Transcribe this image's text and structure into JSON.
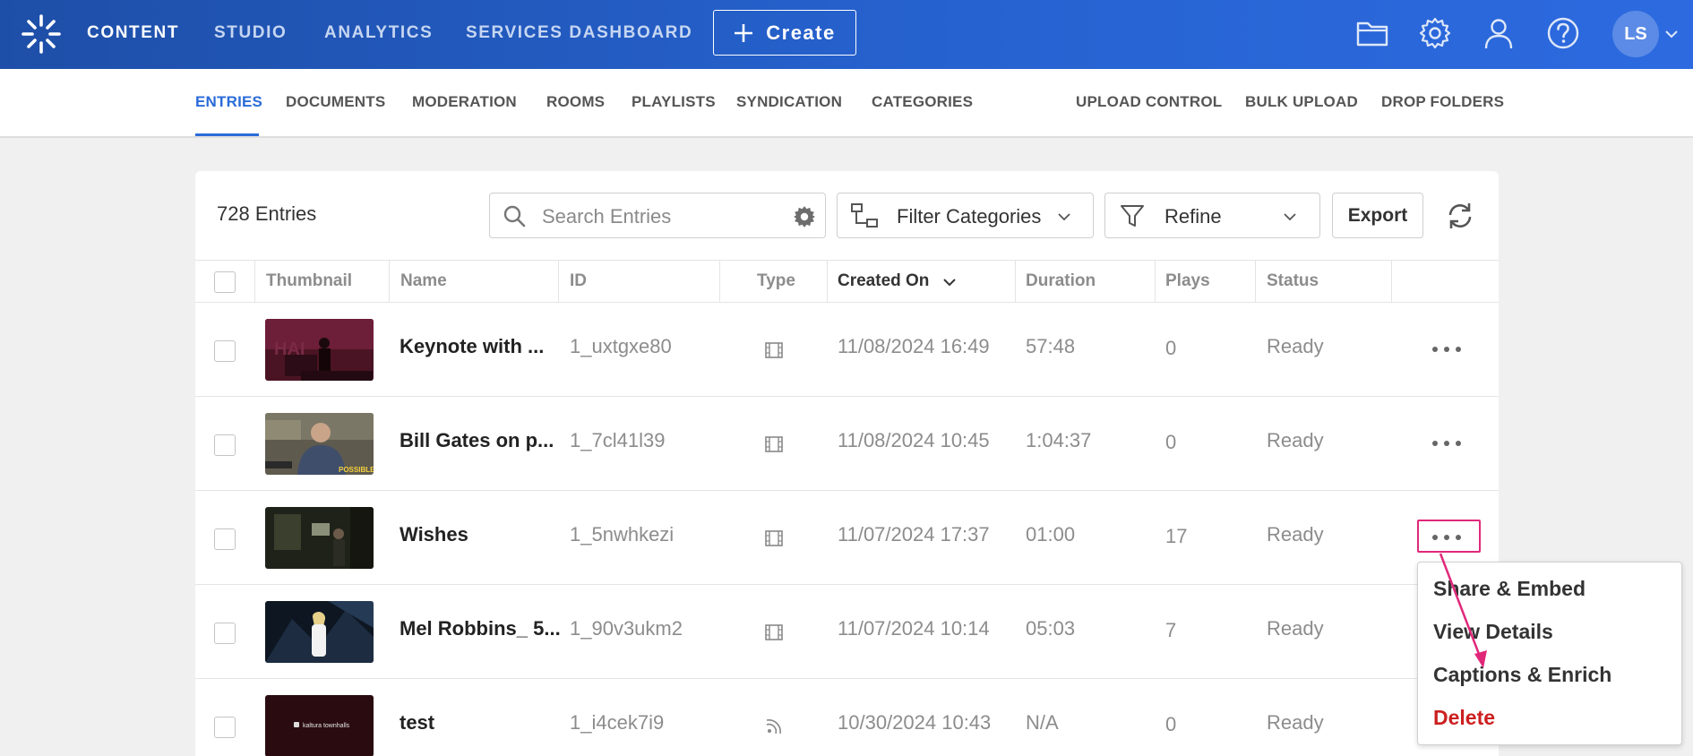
{
  "header": {
    "nav": [
      {
        "label": "CONTENT",
        "active": true
      },
      {
        "label": "STUDIO",
        "active": false
      },
      {
        "label": "ANALYTICS",
        "active": false
      },
      {
        "label": "SERVICES DASHBOARD",
        "active": false
      }
    ],
    "create_label": "Create",
    "icons": [
      "folder-icon",
      "gear-icon",
      "user-icon",
      "help-icon"
    ],
    "avatar_initials": "LS"
  },
  "subnav": {
    "left": [
      "ENTRIES",
      "DOCUMENTS",
      "MODERATION",
      "ROOMS",
      "PLAYLISTS",
      "SYNDICATION",
      "CATEGORIES"
    ],
    "right": [
      "UPLOAD CONTROL",
      "BULK UPLOAD",
      "DROP FOLDERS"
    ],
    "active": "ENTRIES"
  },
  "toolbar": {
    "entries_count": "728 Entries",
    "search_placeholder": "Search Entries",
    "filter_label": "Filter Categories",
    "refine_label": "Refine",
    "export_label": "Export"
  },
  "table": {
    "columns": [
      "Thumbnail",
      "Name",
      "ID",
      "Type",
      "Created On",
      "Duration",
      "Plays",
      "Status"
    ],
    "sorted_column": "Created On",
    "rows": [
      {
        "name": "Keynote with ...",
        "id": "1_uxtgxe80",
        "type": "video",
        "created": "11/08/2024 16:49",
        "duration": "57:48",
        "plays": "0",
        "status": "Ready"
      },
      {
        "name": "Bill Gates on p...",
        "id": "1_7cl41l39",
        "type": "video",
        "created": "11/08/2024 10:45",
        "duration": "1:04:37",
        "plays": "0",
        "status": "Ready"
      },
      {
        "name": "Wishes",
        "id": "1_5nwhkezi",
        "type": "video",
        "created": "11/07/2024 17:37",
        "duration": "01:00",
        "plays": "17",
        "status": "Ready"
      },
      {
        "name": "Mel Robbins_ 5...",
        "id": "1_90v3ukm2",
        "type": "video",
        "created": "11/07/2024 10:14",
        "duration": "05:03",
        "plays": "7",
        "status": "Ready"
      },
      {
        "name": "test",
        "id": "1_i4cek7i9",
        "type": "live",
        "created": "10/30/2024 10:43",
        "duration": "N/A",
        "plays": "0",
        "status": "Ready"
      }
    ]
  },
  "thumb_texts": {
    "row1": "POSSIBLE",
    "row5": "kaltura townhalls"
  },
  "context_menu": {
    "items": [
      "Share & Embed",
      "View Details",
      "Captions & Enrich",
      "Delete"
    ]
  },
  "colors": {
    "accent": "#2a6bd8",
    "header": "#2662cf",
    "highlight": "#e0287a",
    "danger": "#cc1f1f"
  }
}
